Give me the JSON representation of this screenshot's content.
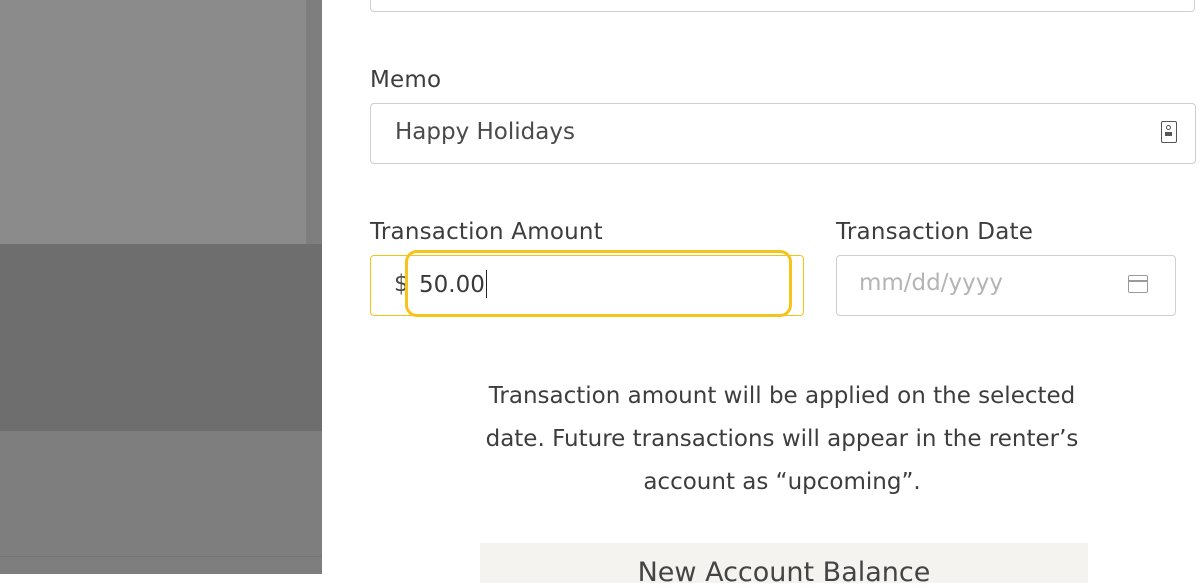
{
  "memo": {
    "label": "Memo",
    "value": "Happy Holidays",
    "icon": "contact-card-icon"
  },
  "amount": {
    "label": "Transaction Amount",
    "currency_symbol": "$",
    "value": "50.00"
  },
  "date": {
    "label": "Transaction Date",
    "placeholder": "mm/dd/yyyy",
    "icon": "calendar-icon"
  },
  "info_text": "Transaction amount will be applied on the selected date. Future transactions will appear in the renter’s account as “upcoming”.",
  "balance": {
    "label": "New Account Balance"
  },
  "colors": {
    "highlight": "#f7c31b",
    "backdrop": "#7e7e7e"
  }
}
